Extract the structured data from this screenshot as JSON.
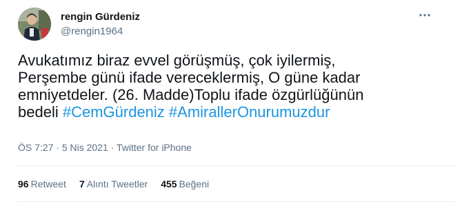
{
  "user": {
    "display_name": "rengin Gürdeniz",
    "handle": "@rengin1964",
    "avatar_icon": "user-photo"
  },
  "more_icon": "more-horizontal-icon",
  "tweet": {
    "line1": "Avukatımız biraz evvel görüşmüş, çok iyilermiş,",
    "line2": "Perşembe günü ifade vereceklermiş, O güne kadar",
    "line3": "emniyetdeler. (26. Madde)Toplu ifade özgürlüğünün",
    "line4_text": "bedeli ",
    "hashtag1": "#CemGürdeniz",
    "hashtag2": "#AmirallerOnurumuzdur"
  },
  "meta": {
    "time": "ÖS 7:27",
    "separator1": " · ",
    "date": "5 Nis 2021",
    "separator2": " · ",
    "source": "Twitter for iPhone"
  },
  "stats": {
    "retweets_count": "96",
    "retweets_label": "Retweet",
    "quotes_count": "7",
    "quotes_label": "Alıntı Tweetler",
    "likes_count": "455",
    "likes_label": "Beğeni"
  },
  "colors": {
    "hashtag": "#1b95e0",
    "secondary_text": "#5b7083",
    "primary_text": "#0f1419",
    "divider": "#ebeef0"
  }
}
